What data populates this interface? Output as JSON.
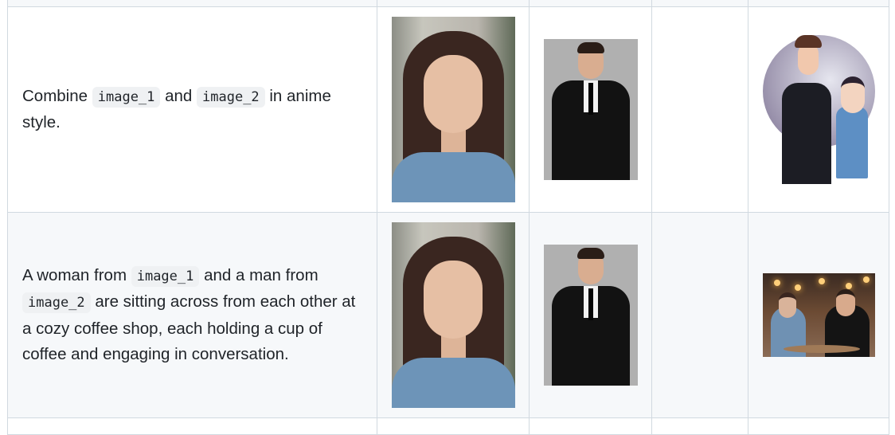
{
  "rows": [
    {
      "prompt": {
        "t1": "Combine ",
        "c1": "image_1",
        "t2": " and ",
        "c2": "image_2",
        "t3": " in anime style."
      }
    },
    {
      "prompt": {
        "t1": "A woman from ",
        "c1": "image_1",
        "t2": " and a man from ",
        "c2": "image_2",
        "t3": " are sitting across from each other at a cozy coffee shop, each holding a cup of coffee and engaging in conversation."
      }
    }
  ],
  "icons": {
    "image_1": "portrait-woman-photo",
    "image_2": "portrait-man-suit-photo",
    "output_row1": "anime-couple-illustration",
    "output_row2": "coffee-shop-couple-photo"
  }
}
